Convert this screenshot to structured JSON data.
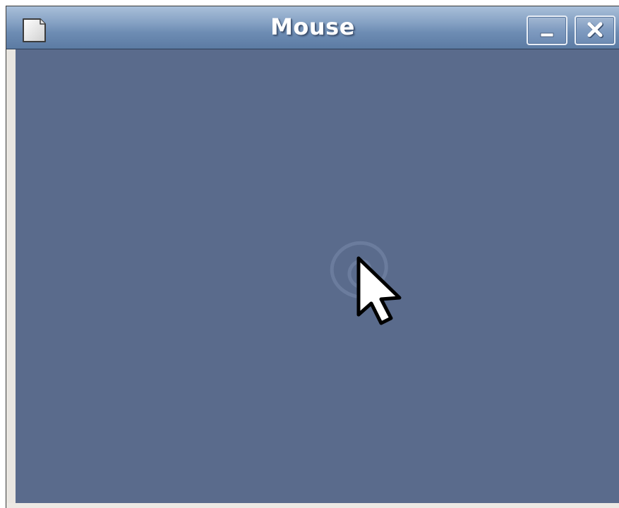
{
  "window": {
    "title": "Mouse",
    "controls": {
      "minimize_icon": "minimize-icon",
      "close_icon": "close-icon"
    }
  },
  "colors": {
    "titlebar": "#7592b8",
    "client_background": "#5a6b8c",
    "frame": "#e9e6e1",
    "cursor_fill": "#ffffff",
    "cursor_outline": "#000000"
  },
  "icons": {
    "app": "document-icon",
    "pointer": "mouse-pointer-icon",
    "watermark": "debian-swirl-icon"
  }
}
